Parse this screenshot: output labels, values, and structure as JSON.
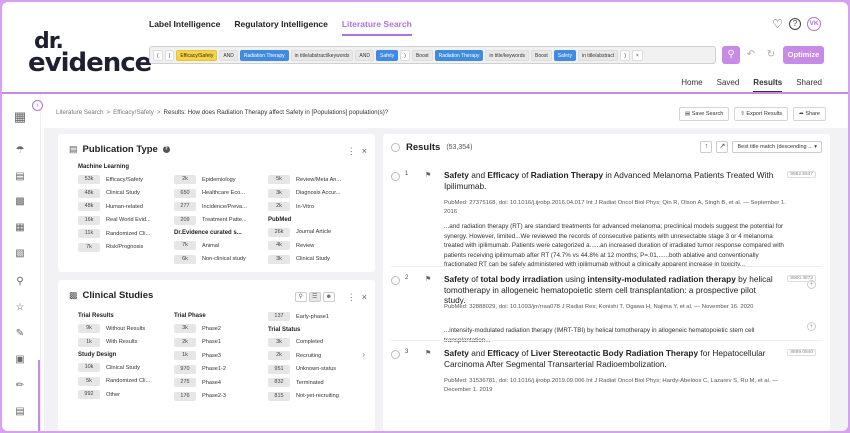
{
  "logo": {
    "line1": "dr.",
    "line2": "evidence"
  },
  "nav": {
    "tabs": [
      "Label Intelligence",
      "Regulatory Intelligence",
      "Literature Search"
    ]
  },
  "user": {
    "initials": "VK"
  },
  "query": {
    "tokens": [
      "(",
      "(",
      "Efficacy/Safety",
      "AND",
      "Radiation Therapy",
      "in title/abstract/keywords",
      "AND",
      "Safety",
      ")",
      "Boost",
      "Radiation Therapy",
      "in title/keywords",
      "Boost",
      "Safety",
      "in title/abstract",
      ")"
    ]
  },
  "optimize_label": "Optimize",
  "subnav": [
    "Home",
    "Saved",
    "Results",
    "Shared"
  ],
  "breadcrumb": {
    "a": "Literature Search",
    "b": "Efficacy/Safety",
    "c": "Results: How does Radiation Therapy affect Safety in [Populations] population(s)?"
  },
  "actions": {
    "save": "Save Search",
    "export": "Export Results",
    "share": "Share"
  },
  "publication_type": {
    "title": "Publication Type",
    "col1": {
      "header": "Machine Learning",
      "rows": [
        [
          "53k",
          "Efficacy/Safety"
        ],
        [
          "48k",
          "Clinical Study"
        ],
        [
          "48k",
          "Human-related"
        ],
        [
          "16k",
          "Real World Evid..."
        ],
        [
          "11k",
          "Randomized Cli..."
        ],
        [
          "7k",
          "Risk/Prognosis"
        ]
      ]
    },
    "col2a": {
      "rows": [
        [
          "2k",
          "Epidemiology"
        ],
        [
          "650",
          "Healthcare Eco..."
        ],
        [
          "277",
          "Incidence/Preva..."
        ],
        [
          "209",
          "Treatment Patte..."
        ]
      ]
    },
    "col2b": {
      "header": "Dr.Evidence curated s...",
      "rows": [
        [
          "7k",
          "Animal"
        ],
        [
          "6k",
          "Non-clinical study"
        ]
      ]
    },
    "col3a": {
      "rows": [
        [
          "5k",
          "Review/Meta An..."
        ],
        [
          "3k",
          "Diagnosis Accur..."
        ],
        [
          "2k",
          "In-Vitro"
        ]
      ]
    },
    "col3b": {
      "header": "PubMed",
      "rows": [
        [
          "26k",
          "Journal Article"
        ],
        [
          "4k",
          "Review"
        ],
        [
          "3k",
          "Clinical Study"
        ]
      ]
    }
  },
  "clinical_studies": {
    "title": "Clinical Studies",
    "col1a": {
      "header": "Trial Results",
      "rows": [
        [
          "9k",
          "Without Results"
        ],
        [
          "1k",
          "With Results"
        ]
      ]
    },
    "col1b": {
      "header": "Study Design",
      "rows": [
        [
          "10k",
          "Clinical Study"
        ],
        [
          "5k",
          "Randomized Cli..."
        ],
        [
          "992",
          "Other"
        ]
      ]
    },
    "col2": {
      "header": "Trial Phase",
      "rows": [
        [
          "3k",
          "Phase2"
        ],
        [
          "2k",
          "Phase1"
        ],
        [
          "1k",
          "Phase3"
        ],
        [
          "970",
          "Phase1-2"
        ],
        [
          "275",
          "Phase4"
        ],
        [
          "176",
          "Phase2-3"
        ]
      ]
    },
    "col3a": {
      "rows": [
        [
          "137",
          "Early-phase1"
        ]
      ]
    },
    "col3b": {
      "header": "Trial Status",
      "rows": [
        [
          "3k",
          "Completed"
        ],
        [
          "2k",
          "Recruiting"
        ],
        [
          "951",
          "Unknown-status"
        ],
        [
          "832",
          "Terminated"
        ],
        [
          "815",
          "Not-yet-recruiting"
        ]
      ]
    }
  },
  "results": {
    "title": "Results",
    "count": "(53,354)",
    "sort": "Best title match (descending ...",
    "items": [
      {
        "num": "1",
        "score": "9962.5547",
        "t1": "Safety",
        "t2": " and ",
        "t3": "Efficacy",
        "t4": " of ",
        "t5": "Radiation Therapy",
        "t6": " in Advanced Melanoma Patients Treated With Ipilimumab.",
        "meta": "PubMed: 27375168, doi: 10.1016/j.ijrobp.2016.04.017 Int J Radiat Oncol Biol Phys; Qin R, Olson A, Singh B, et al. — September 1. 2016",
        "snip": "...and radiation therapy (RT) are standard treatments for advanced melanoma; preclinical models suggest the potential for synergy. However, limited...We reviewed the records of consecutive patients with unresectable stage 3 or 4 melanoma treated with ipilimumab. Patients were categorized a......an increased duration of irradiated tumor response compared with patients receiving ipilimumab after RT (74.7% vs 44.8% at 12 months; P=.01,......both ablative and conventionally fractionated RT can be safely administered with ipilimumab without a clinically apparent increase in toxicity..."
      },
      {
        "num": "2",
        "score": "8900.3872",
        "t1": "Safety",
        "t2": " of ",
        "t3": "total body irradiation",
        "t4": " using ",
        "t5": "intensity-modulated radiation therapy",
        "t6": " by helical tomotherapy in allogeneic hematopoietic stem cell transplantation: a prospective pilot study.",
        "meta": "PubMed: 32888029, doi: 10.1093/jrr/rraa078 J Radiat Res; Konishi T, Ogawa H, Najima Y, et al. — November 16. 2020",
        "snip": "...intensity-modulated radiation therapy (IMRT-TBI) by helical tomotherapy in allogeneic hematopoietic stem cell transplantation..."
      },
      {
        "num": "3",
        "score": "8899.0840",
        "t1": "Safety",
        "t2": " and ",
        "t3": "Efficacy",
        "t4": " of ",
        "t5": "Liver Stereotactic Body Radiation Therapy",
        "t6": " for Hepatocellular Carcinoma After Segmental Transarterial Radioembolization.",
        "meta": "PubMed: 31536781, doi: 10.1016/j.ijrobp.2019.09.006 Int J Radiat Oncol Biol Phys; Hardy-Abeloos C, Lazarev S, Ru M, et al. — December 1. 2019",
        "snip": ""
      }
    ]
  }
}
